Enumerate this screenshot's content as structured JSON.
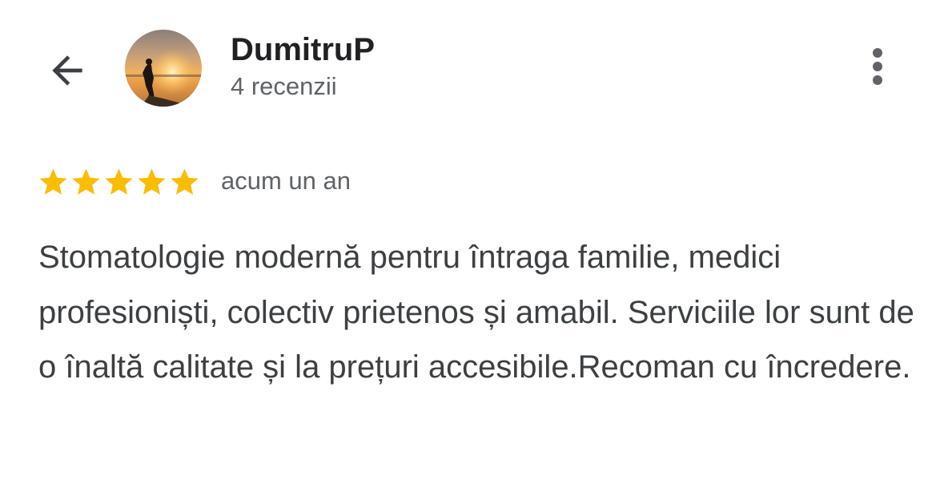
{
  "header": {
    "back_icon": "arrow-left-icon",
    "avatar_icon": "sunset-silhouette-avatar",
    "user_name": "DumitruP",
    "review_count": "4 recenzii",
    "more_icon": "more-vertical-icon"
  },
  "review": {
    "rating": 5,
    "rating_max": 5,
    "star_color": "#fbbc04",
    "date": "acum un an",
    "text": "Stomatologie modernă pentru întraga familie, medici profesioniști, colectiv prietenos și amabil. Serviciile lor sunt de o înaltă calitate și la prețuri accesibile.Recoman cu încredere."
  }
}
